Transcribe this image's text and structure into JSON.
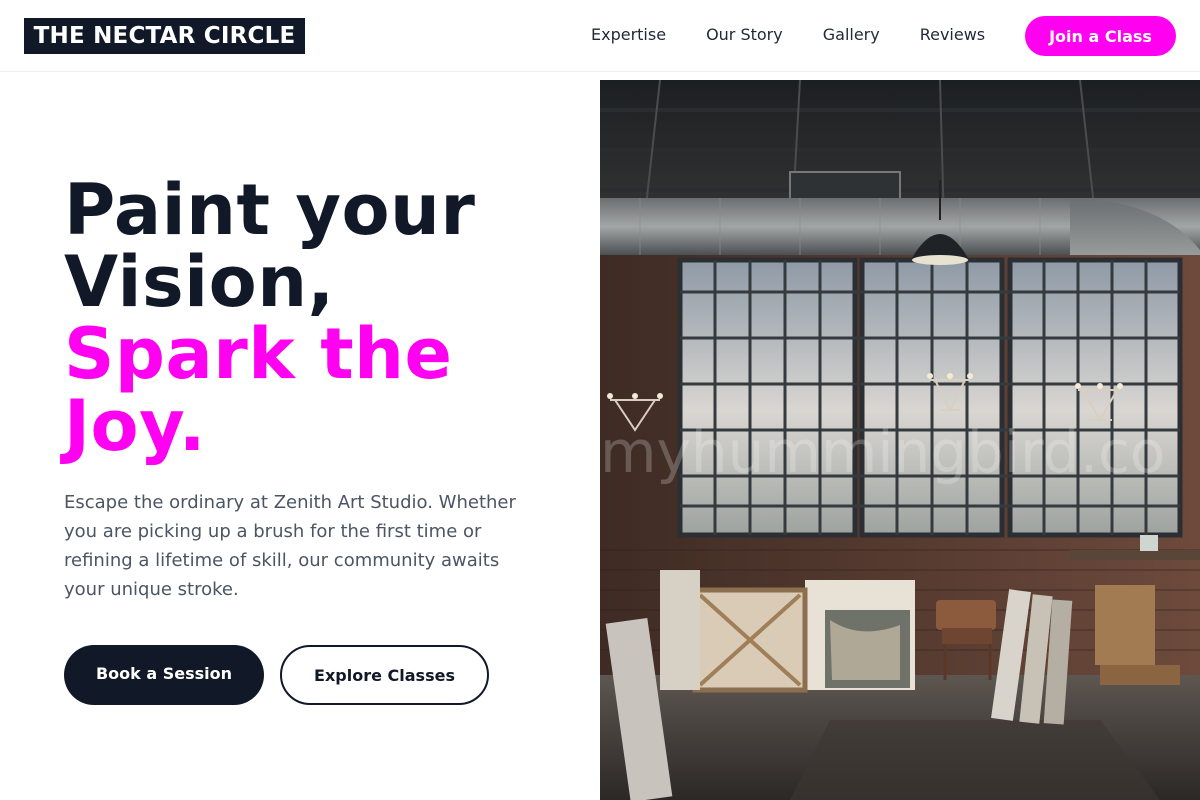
{
  "brand": {
    "name": "THE NECTAR CIRCLE"
  },
  "nav": {
    "items": [
      {
        "label": "Expertise"
      },
      {
        "label": "Our Story"
      },
      {
        "label": "Gallery"
      },
      {
        "label": "Reviews"
      }
    ],
    "cta_label": "Join a Class"
  },
  "hero": {
    "title_dark_1": "Paint your",
    "title_dark_2": "Vision,",
    "title_pink_1": "Spark the",
    "title_pink_2": "Joy.",
    "description": "Escape the ordinary at Zenith Art Studio. Whether you are picking up a brush for the first time or refining a lifetime of skill, our community awaits your unique stroke.",
    "primary_button": "Book a Session",
    "secondary_button": "Explore Classes",
    "image_watermark": "myhummingbird.co"
  },
  "colors": {
    "brand_dark": "#111827",
    "accent_pink": "#ff00f0",
    "text_muted": "#4b5563"
  }
}
